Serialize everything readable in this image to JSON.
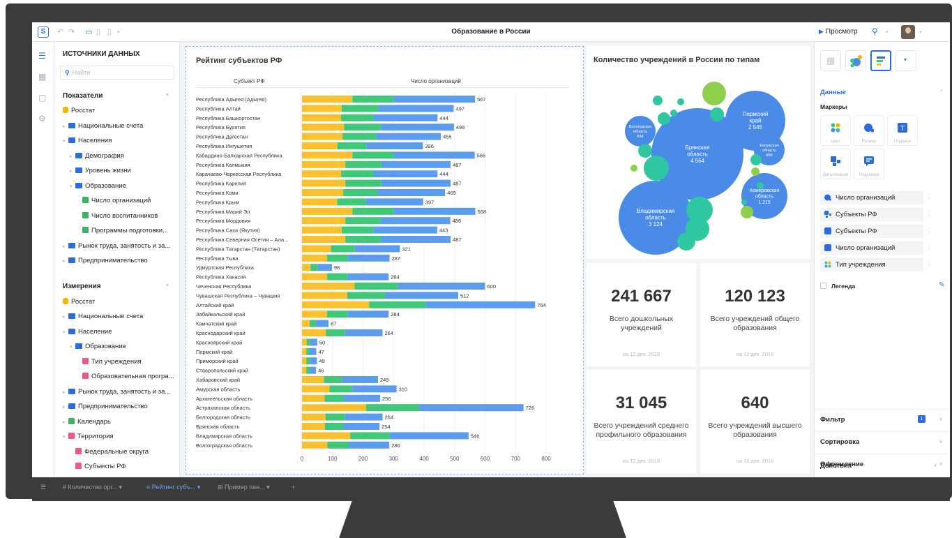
{
  "app": {
    "title": "Образование в России",
    "preview_label": "Просмотр"
  },
  "sources": {
    "header": "ИСТОЧНИКИ ДАННЫХ",
    "search_placeholder": "Найти",
    "indicators_title": "Показатели",
    "dimensions_title": "Измерения",
    "indicators": [
      {
        "label": "Росстат"
      },
      {
        "label": "Национальные счета"
      },
      {
        "label": "Населения"
      },
      {
        "label": "Демография"
      },
      {
        "label": "Уровень жизни"
      },
      {
        "label": "Образование"
      },
      {
        "label": "Число организаций"
      },
      {
        "label": "Число воспитанников"
      },
      {
        "label": "Программы подготовки..."
      },
      {
        "label": "Рынок труда, занятость и за..."
      },
      {
        "label": "Предпринимательство"
      }
    ],
    "dimensions": [
      {
        "label": "Росстат"
      },
      {
        "label": "Национальные счета"
      },
      {
        "label": "Население"
      },
      {
        "label": "Образование"
      },
      {
        "label": "Тип учреждения"
      },
      {
        "label": "Образовательная програ..."
      },
      {
        "label": "Рынок труда, занятость и за..."
      },
      {
        "label": "Предпринимательство"
      },
      {
        "label": "Календарь"
      },
      {
        "label": "Территория"
      },
      {
        "label": "Федеральные округа"
      },
      {
        "label": "Субъекты РФ"
      }
    ]
  },
  "bar_widget": {
    "title": "Рейтинг субъектов РФ",
    "col_subject": "Субъект РФ",
    "col_count": "Число организаций"
  },
  "bubble_widget": {
    "title": "Количество учреждений в России по типам"
  },
  "kpis": [
    {
      "value": "241 667",
      "label": "Всего дошкольных учреждений",
      "date": "на 12 дек. 2018"
    },
    {
      "value": "120 123",
      "label": "Всего учреждений общего образования",
      "date": "на 12 дек. 2018"
    },
    {
      "value": "31 045",
      "label": "Всего учреждений среднего профильного образования",
      "date": "на 12 дек. 2018"
    },
    {
      "value": "640",
      "label": "Всего учреждений высшего образования",
      "date": "на 12 дек. 2018"
    }
  ],
  "settings": {
    "data_label": "Данные",
    "markers_label": "Маркеры",
    "marker_tiles": [
      "Цвет",
      "Размер",
      "Подписи",
      "Детализация",
      "Подсказка"
    ],
    "fields": [
      {
        "label": "Число организаций",
        "icon": "size-icon"
      },
      {
        "label": "Субъекты РФ",
        "icon": "detail-icon"
      },
      {
        "label": "Субъекты РФ",
        "icon": "labels-icon"
      },
      {
        "label": "Число организаций",
        "icon": "labels-icon"
      },
      {
        "label": "Тип учреждения",
        "icon": "color-icon"
      }
    ],
    "legend_label": "Легенда",
    "filter_label": "Фильтр",
    "filter_count": "1",
    "sort_label": "Сортировка",
    "format_label": "Оформление",
    "actions_label": "Действия"
  },
  "tabs": [
    {
      "label": "Количество орг..."
    },
    {
      "label": "Рейтинг субъ..."
    },
    {
      "label": "Пример пан..."
    }
  ],
  "colors": {
    "accent": "#2d6cdf",
    "segment1": "#fbc02d",
    "segment2": "#3ec878",
    "segment3": "#5b9cef",
    "bubble_blue": "#4a8be8",
    "bubble_teal": "#2fc6a2",
    "bubble_lime": "#8fcf4e"
  },
  "chart_data": [
    {
      "type": "bar",
      "orientation": "horizontal",
      "stacked": true,
      "title": "Рейтинг субъектов РФ",
      "xlabel": "Число организаций",
      "ylabel": "Субъект РФ",
      "xlim": [
        0,
        800
      ],
      "xticks": [
        0,
        100,
        200,
        300,
        400,
        500,
        600,
        700,
        800
      ],
      "categories": [
        "Республика Адыгея (Адыгея)",
        "Республика Алтай",
        "Республика Башкортостан",
        "Республика Бурятия",
        "Республика Дагестан",
        "Республика Ингушетия",
        "Кабардино-Балкарская Республика",
        "Республика Калмыкия",
        "Карачаево-Черкесская Республика",
        "Республика Карелия",
        "Республика Коми",
        "Республика Крым",
        "Республика Марий Эл",
        "Республика Мордовия",
        "Республика Саха (Якутия)",
        "Республика Северная Осетия – Ала...",
        "Республика Татарстан (Татарстан)",
        "Республика Тыва",
        "Удмуртская Республика",
        "Республика Хакасия",
        "Чеченская Республика",
        "Чувашская Республика – Чувашия",
        "Алтайский край",
        "Забайкальский край",
        "Камчатский край",
        "Краснодарский край",
        "Красноярский край",
        "Пермский край",
        "Приморский край",
        "Ставропольский край",
        "Хабаровский край",
        "Амурская область",
        "Архангельская область",
        "Астраханская область",
        "Белгородская область",
        "Брянская область",
        "Владимирская область",
        "Волгоградская область"
      ],
      "totals": [
        567,
        497,
        444,
        498,
        455,
        396,
        566,
        487,
        444,
        487,
        469,
        397,
        568,
        486,
        443,
        487,
        321,
        287,
        98,
        284,
        600,
        512,
        764,
        284,
        87,
        264,
        50,
        47,
        49,
        46,
        249,
        310,
        256,
        726,
        264,
        254,
        546,
        286
      ],
      "series": [
        {
          "values": [
            165,
            130,
            128,
            138,
            133,
            116,
            165,
            142,
            128,
            142,
            135,
            115,
            165,
            142,
            130,
            142,
            95,
            82,
            28,
            82,
            172,
            148,
            220,
            82,
            25,
            78,
            15,
            14,
            14,
            14,
            72,
            90,
            74,
            210,
            77,
            75,
            158,
            83
          ]
        },
        {
          "values": [
            135,
            120,
            105,
            120,
            110,
            95,
            135,
            118,
            105,
            118,
            112,
            95,
            135,
            116,
            104,
            116,
            78,
            68,
            24,
            68,
            142,
            124,
            185,
            68,
            21,
            63,
            12,
            11,
            12,
            11,
            60,
            75,
            62,
            174,
            64,
            61,
            131,
            69
          ]
        },
        {
          "values": [
            267,
            247,
            211,
            240,
            212,
            185,
            266,
            227,
            211,
            227,
            222,
            187,
            268,
            228,
            209,
            229,
            148,
            137,
            46,
            134,
            286,
            240,
            359,
            134,
            41,
            123,
            23,
            22,
            23,
            21,
            117,
            145,
            120,
            342,
            123,
            118,
            257,
            134
          ]
        }
      ],
      "value_labels": [
        "567",
        "497",
        "444",
        "498",
        "455",
        "396",
        "566",
        "487",
        "444",
        "487",
        "469",
        "397",
        "568",
        "486",
        "443",
        "487",
        "321",
        "287",
        "98",
        "284",
        "600",
        "512",
        "764",
        "284",
        "87",
        "264",
        "50",
        "47",
        "49",
        "46",
        "249",
        "310",
        "256",
        "726",
        "264",
        "254",
        "546",
        "286"
      ]
    },
    {
      "type": "scatter",
      "subtype": "bubble",
      "title": "Количество учреждений в России по типам",
      "labeled_bubbles": [
        {
          "name": "Брянская область",
          "value": 4564
        },
        {
          "name": "Владимирская область",
          "value": 3124
        },
        {
          "name": "Пермский край",
          "value": 2545
        },
        {
          "name": "Кемеровская область",
          "value": 1215
        },
        {
          "name": "Калужская область",
          "value": 896
        },
        {
          "name": "Вологодская область",
          "value": 834
        }
      ]
    }
  ]
}
